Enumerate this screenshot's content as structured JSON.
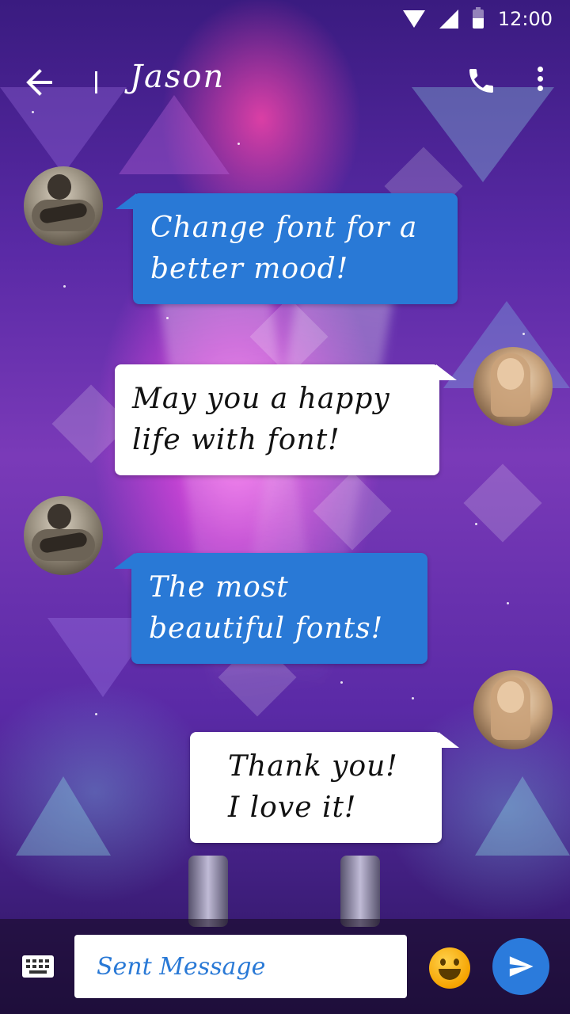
{
  "status_bar": {
    "time": "12:00"
  },
  "header": {
    "contact_name": "Jason"
  },
  "messages": [
    {
      "sender": "Jason",
      "side": "left",
      "style": "blue",
      "lines": [
        "Change font for a",
        "better mood!"
      ]
    },
    {
      "sender": "me",
      "side": "right",
      "style": "white",
      "lines": [
        "May you a happy",
        "life with font!"
      ]
    },
    {
      "sender": "Jason",
      "side": "left",
      "style": "blue",
      "lines": [
        "The most",
        "beautiful fonts!"
      ]
    },
    {
      "sender": "me",
      "side": "right",
      "style": "white",
      "lines": [
        "Thank you!",
        "I love it!"
      ]
    }
  ],
  "composer": {
    "placeholder": "Sent Message"
  },
  "icons": {
    "back": "arrow-left-icon",
    "call": "phone-icon",
    "more": "more-vertical-icon",
    "keyboard": "keyboard-icon",
    "emoji": "smiley-icon",
    "send": "send-icon"
  },
  "colors": {
    "bubble_blue": "#2979d6",
    "bubble_white": "#ffffff",
    "send_button": "#2b7bdc",
    "emoji": "#f5a300"
  }
}
